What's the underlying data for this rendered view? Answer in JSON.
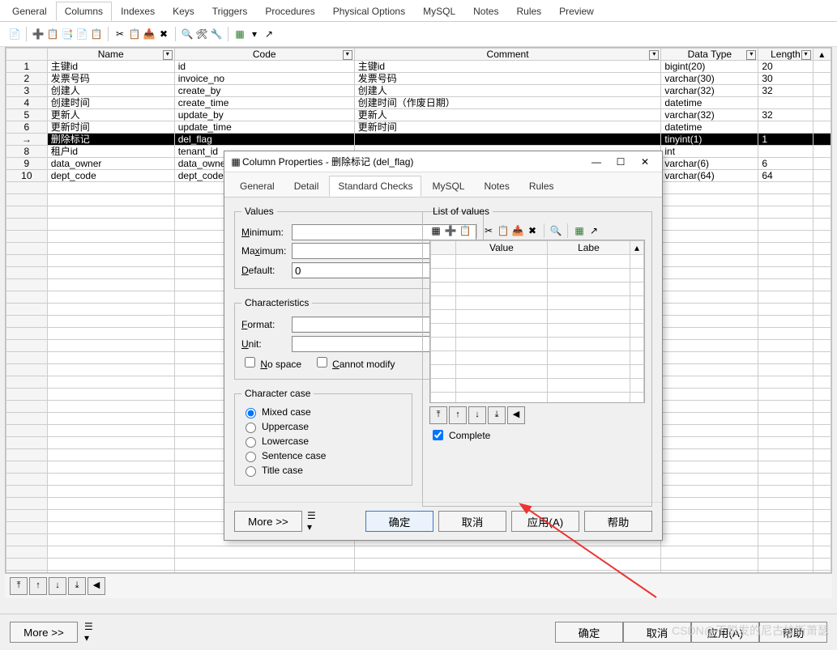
{
  "mainTabs": [
    "General",
    "Columns",
    "Indexes",
    "Keys",
    "Triggers",
    "Procedures",
    "Physical Options",
    "MySQL",
    "Notes",
    "Rules",
    "Preview"
  ],
  "mainActiveTab": 1,
  "gridColumns": [
    "Name",
    "Code",
    "Comment",
    "Data Type",
    "Length"
  ],
  "gridRows": [
    {
      "n": "1",
      "name": "主键id",
      "code": "id",
      "comment": "主键id",
      "type": "bigint(20)",
      "len": "20"
    },
    {
      "n": "2",
      "name": "发票号码",
      "code": "invoice_no",
      "comment": "发票号码",
      "type": "varchar(30)",
      "len": "30"
    },
    {
      "n": "3",
      "name": "创建人",
      "code": "create_by",
      "comment": "创建人",
      "type": "varchar(32)",
      "len": "32"
    },
    {
      "n": "4",
      "name": "创建时间",
      "code": "create_time",
      "comment": "创建时间（作废日期）",
      "type": "datetime",
      "len": ""
    },
    {
      "n": "5",
      "name": "更新人",
      "code": "update_by",
      "comment": "更新人",
      "type": "varchar(32)",
      "len": "32"
    },
    {
      "n": "6",
      "name": "更新时间",
      "code": "update_time",
      "comment": "更新时间",
      "type": "datetime",
      "len": ""
    },
    {
      "n": "→",
      "name": "删除标记",
      "code": "del_flag",
      "comment": "",
      "type": "tinyint(1)",
      "len": "1",
      "sel": true
    },
    {
      "n": "8",
      "name": "租户id",
      "code": "tenant_id",
      "comment": "",
      "type": "int",
      "len": ""
    },
    {
      "n": "9",
      "name": "data_owner",
      "code": "data_owner",
      "comment": "",
      "type": "varchar(6)",
      "len": "6"
    },
    {
      "n": "10",
      "name": "dept_code",
      "code": "dept_code",
      "comment": "",
      "type": "varchar(64)",
      "len": "64"
    }
  ],
  "dialog": {
    "title": "Column Properties - 删除标记 (del_flag)",
    "tabs": [
      "General",
      "Detail",
      "Standard Checks",
      "MySQL",
      "Notes",
      "Rules"
    ],
    "activeTab": 2,
    "values": {
      "min_lbl": "Minimum:",
      "max_lbl": "Maximum:",
      "def_lbl": "Default:",
      "default": "0"
    },
    "chars": {
      "legend": "Characteristics",
      "fmt_lbl": "Format:",
      "unit_lbl": "Unit:",
      "nospace": "No space",
      "cannot": "Cannot modify"
    },
    "ccase": {
      "legend": "Character case",
      "opts": [
        "Mixed case",
        "Uppercase",
        "Lowercase",
        "Sentence case",
        "Title case"
      ],
      "sel": 0
    },
    "lov": {
      "legend": "List of values",
      "cols": [
        "Value",
        "Labe"
      ],
      "complete": "Complete"
    },
    "buttons": {
      "more": "More >>",
      "ok": "确定",
      "cancel": "取消",
      "apply": "应用(A)",
      "help": "帮助"
    }
  },
  "footer": {
    "more": "More >>",
    "ok": "确定",
    "cancel": "取消",
    "apply": "应用(A)",
    "help": "帮助"
  },
  "values_legend": "Values",
  "watermark": "CSDN@不脱发的尼古拉斯萧瑟"
}
